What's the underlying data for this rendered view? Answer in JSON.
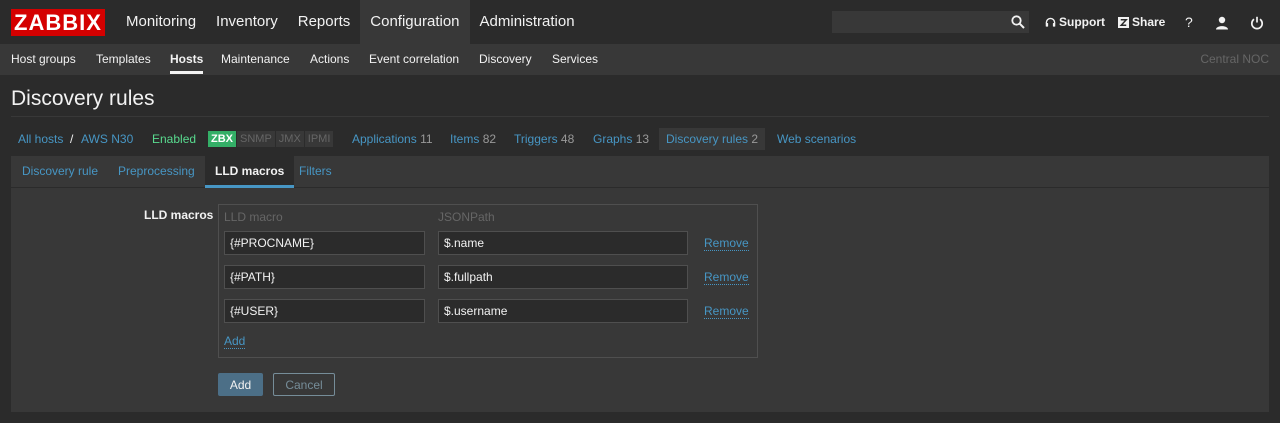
{
  "logo": "ZABBIX",
  "main_menu": [
    "Monitoring",
    "Inventory",
    "Reports",
    "Configuration",
    "Administration"
  ],
  "main_menu_active": "Configuration",
  "search": {
    "value": "",
    "placeholder": ""
  },
  "tools": {
    "support": "Support",
    "share": "Share",
    "help": "?"
  },
  "sub_menu": [
    "Host groups",
    "Templates",
    "Hosts",
    "Maintenance",
    "Actions",
    "Event correlation",
    "Discovery",
    "Services"
  ],
  "sub_menu_active": "Hosts",
  "server_name": "Central NOC",
  "page_title": "Discovery rules",
  "breadcrumbs": {
    "all_hosts": "All hosts",
    "separator": "/",
    "host": "AWS N30",
    "status": "Enabled",
    "availability": [
      "ZBX",
      "SNMP",
      "JMX",
      "IPMI"
    ],
    "applications": {
      "label": "Applications",
      "count": "11"
    },
    "items": {
      "label": "Items",
      "count": "82"
    },
    "triggers": {
      "label": "Triggers",
      "count": "48"
    },
    "graphs": {
      "label": "Graphs",
      "count": "13"
    },
    "discovery_rules": {
      "label": "Discovery rules",
      "count": "2"
    },
    "web_scenarios": "Web scenarios"
  },
  "tabs": [
    "Discovery rule",
    "Preprocessing",
    "LLD macros",
    "Filters"
  ],
  "active_tab": "LLD macros",
  "form": {
    "label": "LLD macros",
    "col_macro": "LLD macro",
    "col_path": "JSONPath",
    "rows": [
      {
        "macro": "{#PROCNAME}",
        "path": "$.name",
        "remove": "Remove"
      },
      {
        "macro": "{#PATH}",
        "path": "$.fullpath",
        "remove": "Remove"
      },
      {
        "macro": "{#USER}",
        "path": "$.username",
        "remove": "Remove"
      }
    ],
    "add_link": "Add"
  },
  "buttons": {
    "add": "Add",
    "cancel": "Cancel"
  },
  "colors": {
    "brand": "#d40000",
    "link": "#4796c4",
    "enabled": "#59db8f",
    "zbx_badge": "#34af67",
    "primary_button": "#4c6f87"
  }
}
